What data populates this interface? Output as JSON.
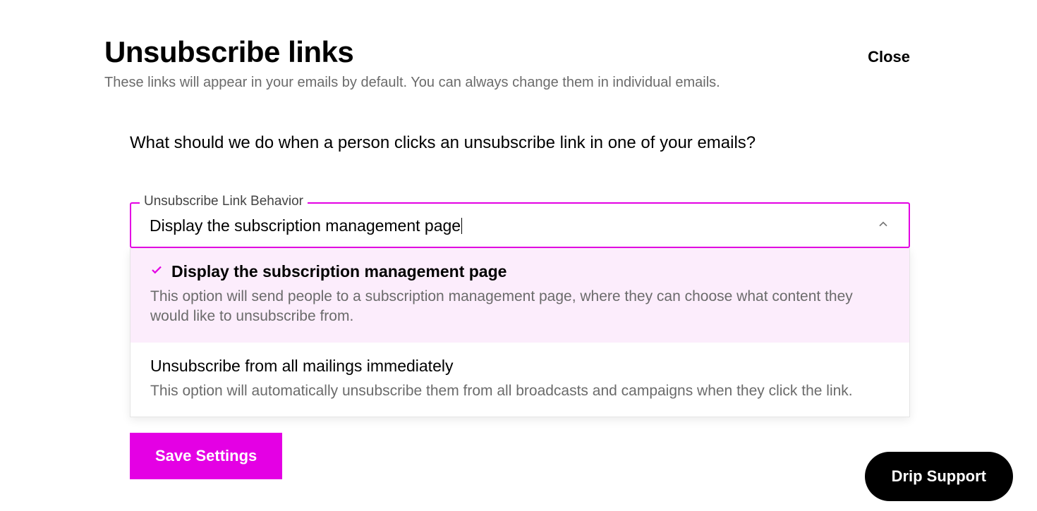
{
  "header": {
    "title": "Unsubscribe links",
    "subtitle": "These links will appear in your emails by default. You can always change them in individual emails.",
    "close_label": "Close"
  },
  "question": "What should we do when a person clicks an unsubscribe link in one of your emails?",
  "select": {
    "label": "Unsubscribe Link Behavior",
    "value": "Display the subscription management page",
    "options": [
      {
        "title": "Display the subscription management page",
        "description": "This option will send people to a subscription management page, where they can choose what content they would like to unsubscribe from.",
        "selected": true
      },
      {
        "title": "Unsubscribe from all mailings immediately",
        "description": "This option will automatically unsubscribe them from all broadcasts and campaigns when they click the link.",
        "selected": false
      }
    ]
  },
  "save_button": "Save Settings",
  "support_button": "Drip Support",
  "colors": {
    "accent": "#e400e4",
    "text_muted": "#6b6b6b"
  }
}
